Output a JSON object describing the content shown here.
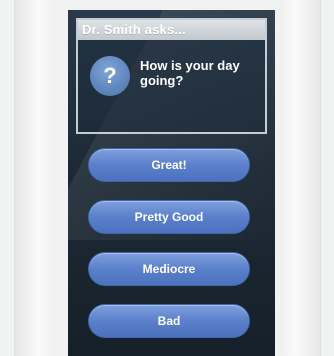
{
  "dialog": {
    "title": "Dr. Smith asks...",
    "question_icon": "?",
    "question": "How is your day going?"
  },
  "answers": [
    {
      "label": "Great!"
    },
    {
      "label": "Pretty Good"
    },
    {
      "label": "Mediocre"
    },
    {
      "label": "Bad"
    }
  ],
  "colors": {
    "button": "#5a80cb",
    "badge": "#6a91c7",
    "screen": "#1d2a36",
    "dialog_title_bar": "#c7ccd2"
  }
}
